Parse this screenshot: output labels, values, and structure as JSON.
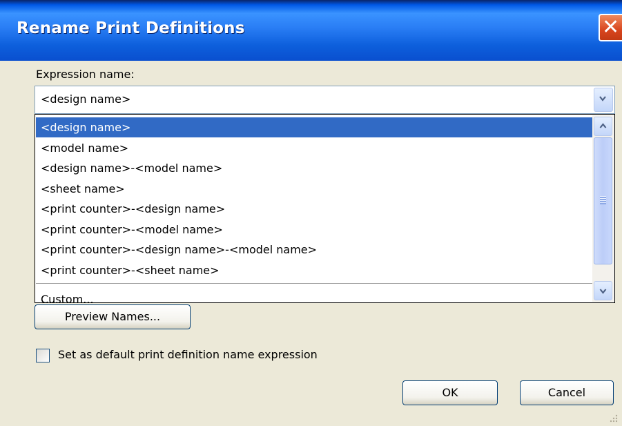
{
  "window": {
    "title": "Rename Print Definitions",
    "close_icon": "close-icon"
  },
  "expression": {
    "label": "Expression name:",
    "value": "<design name>",
    "options": [
      "<design name>",
      "<model name>",
      "<design name>-<model name>",
      "<sheet name>",
      "<print counter>-<design name>",
      "<print counter>-<model name>",
      "<print counter>-<design name>-<model name>",
      "<print counter>-<sheet name>",
      "Custom..."
    ],
    "selected_index": 0
  },
  "buttons": {
    "preview": "Preview Names...",
    "ok": "OK",
    "cancel": "Cancel"
  },
  "checkbox": {
    "label": "Set as default print definition name expression",
    "checked": false
  },
  "colors": {
    "title_bar": "#0a4fcf",
    "selection": "#316ac5",
    "dialog_bg": "#ece9d8",
    "close": "#d8451e"
  }
}
